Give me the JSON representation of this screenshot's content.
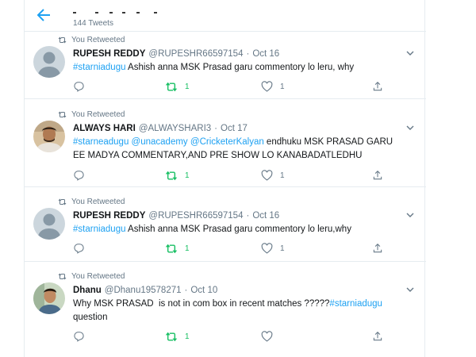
{
  "header": {
    "tweet_count": "144 Tweets"
  },
  "colors": {
    "accent": "#1da1f2",
    "retweet_green": "#17bf63",
    "secondary_text": "#657786",
    "divider": "#e6ecf0"
  },
  "tweets": [
    {
      "retweet_label": "You Retweeted",
      "name": "RUPESH REDDY",
      "handle": "@RUPESHR66597154",
      "dot": "·",
      "date": "Oct 16",
      "text_parts": [
        "#starniadugu",
        " Ashish anna MSK Prasad garu commentory lo leru, why"
      ],
      "retweets": "1",
      "likes": "1"
    },
    {
      "retweet_label": "You Retweeted",
      "name": "ALWAYS HARI",
      "handle": "@ALWAYSHARI3",
      "dot": "·",
      "date": "Oct 17",
      "text_parts": [
        "#starneadugu",
        " ",
        "@unacademy",
        " ",
        "@CricketerKalyan",
        " endhuku MSK PRASAD GARU EE MADYA COMMENTARY,AND PRE SHOW LO KANABADATLEDHU"
      ],
      "retweets": "1",
      "likes": "1"
    },
    {
      "retweet_label": "You Retweeted",
      "name": "RUPESH REDDY",
      "handle": "@RUPESHR66597154",
      "dot": "·",
      "date": "Oct 16",
      "text_parts": [
        "#starniadugu",
        " Ashish anna MSK Prasad garu commentory lo leru,why"
      ],
      "retweets": "1",
      "likes": "1"
    },
    {
      "retweet_label": "You Retweeted",
      "name": "Dhanu",
      "handle": "@Dhanu19578271",
      "dot": "·",
      "date": "Oct 10",
      "text_parts": [
        "Why MSK PRASAD  is not in com box in recent matches ?????",
        "#starniadugu",
        " question"
      ],
      "retweets": "1",
      "likes": ""
    }
  ]
}
